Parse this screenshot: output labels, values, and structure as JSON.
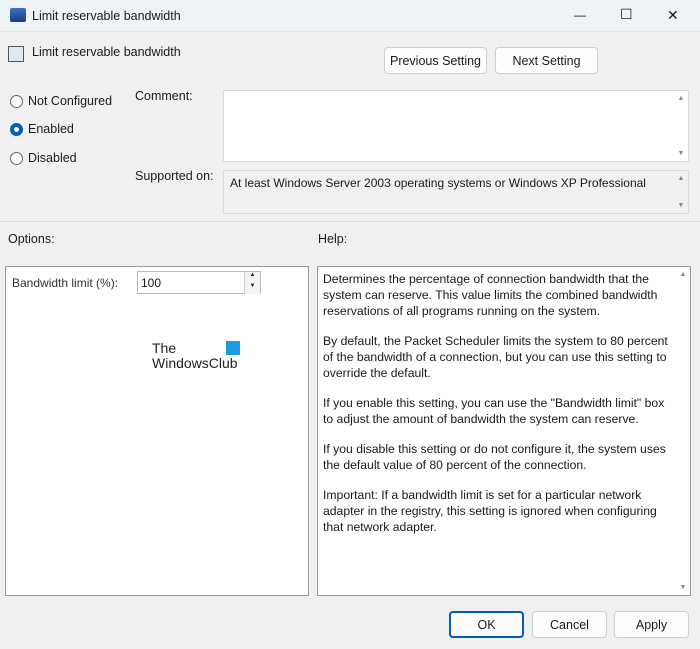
{
  "window": {
    "title": "Limit reservable bandwidth",
    "minimize": "—",
    "maximize": "☐",
    "close": "✕"
  },
  "header": {
    "setting_name": "Limit reservable bandwidth",
    "prev": "Previous Setting",
    "next": "Next Setting"
  },
  "state": {
    "options": [
      "Not Configured",
      "Enabled",
      "Disabled"
    ],
    "selected": "Enabled"
  },
  "comment": {
    "label": "Comment:",
    "value": ""
  },
  "supported": {
    "label": "Supported on:",
    "value": "At least Windows Server 2003 operating systems or Windows XP Professional"
  },
  "options_label": "Options:",
  "help_label": "Help:",
  "bandwidth": {
    "label": "Bandwidth limit (%):",
    "value": "100"
  },
  "watermark": {
    "line1": "The",
    "line2": "WindowsClub"
  },
  "help": [
    "Determines the percentage of connection bandwidth that the system can reserve. This value limits the combined bandwidth reservations of all programs running on the system.",
    "By default, the Packet Scheduler limits the system to 80 percent of the bandwidth of a connection, but you can use this setting to override the default.",
    "If you enable this setting, you can use the \"Bandwidth limit\" box to adjust the amount of bandwidth the system can reserve.",
    "If you disable this setting or do not configure it, the system uses the default value of 80 percent of the connection.",
    "Important: If a bandwidth limit is set for a particular network adapter in the registry, this setting is ignored when configuring that network adapter."
  ],
  "footer": {
    "ok": "OK",
    "cancel": "Cancel",
    "apply": "Apply"
  }
}
